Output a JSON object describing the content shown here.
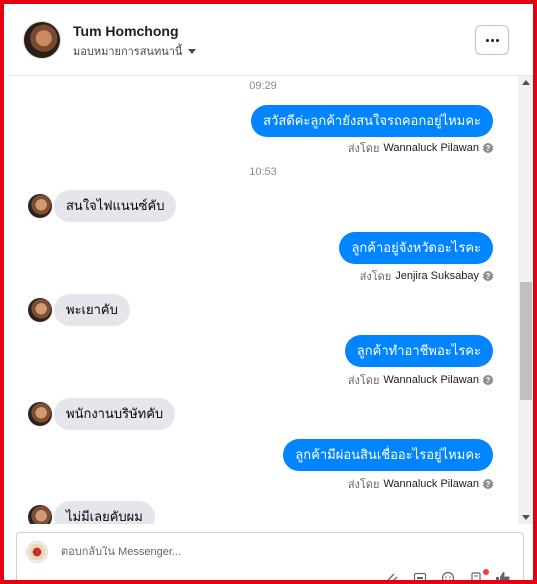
{
  "header": {
    "contact_name": "Tum Homchong",
    "assign_label": "มอบหมายการสนทนานี้"
  },
  "conversation": {
    "time_1": "09:29",
    "time_2": "10:53",
    "messages": [
      {
        "dir": "out",
        "text": "สวัสดีค่ะลูกค้ายังสนใจรถคอกอยู่ไหมคะ",
        "sent_by_label": "ส่งโดย",
        "agent": "Wannaluck Pilawan"
      },
      {
        "dir": "in",
        "text": "สนใจไฟแนนซ์คับ"
      },
      {
        "dir": "out",
        "text": "ลูกค้าอยู่จังหวัดอะไรคะ",
        "sent_by_label": "ส่งโดย",
        "agent": "Jenjira Suksabay"
      },
      {
        "dir": "in",
        "text": "พะเยาคับ"
      },
      {
        "dir": "out",
        "text": "ลูกค้าทำอาชีพอะไรคะ",
        "sent_by_label": "ส่งโดย",
        "agent": "Wannaluck Pilawan"
      },
      {
        "dir": "in",
        "text": "พนักงานบริษัทคับ"
      },
      {
        "dir": "out",
        "text": "ลูกค้ามีผ่อนสินเชื่ออะไรอยู่ไหมคะ",
        "sent_by_label": "ส่งโดย",
        "agent": "Wannaluck Pilawan"
      },
      {
        "dir": "in",
        "text": "ไม่มีเลยคับผม"
      }
    ]
  },
  "composer": {
    "placeholder": "ตอบกลับใน Messenger..."
  },
  "colors": {
    "accent": "#0084ff",
    "incoming_bubble": "#e4e6eb",
    "frame_border": "#e4000f"
  },
  "icons": [
    "more-dots-icon",
    "caret-down-icon",
    "question-icon",
    "attachment-icon",
    "gif-icon",
    "emoji-icon",
    "sticker-icon",
    "like-icon"
  ]
}
